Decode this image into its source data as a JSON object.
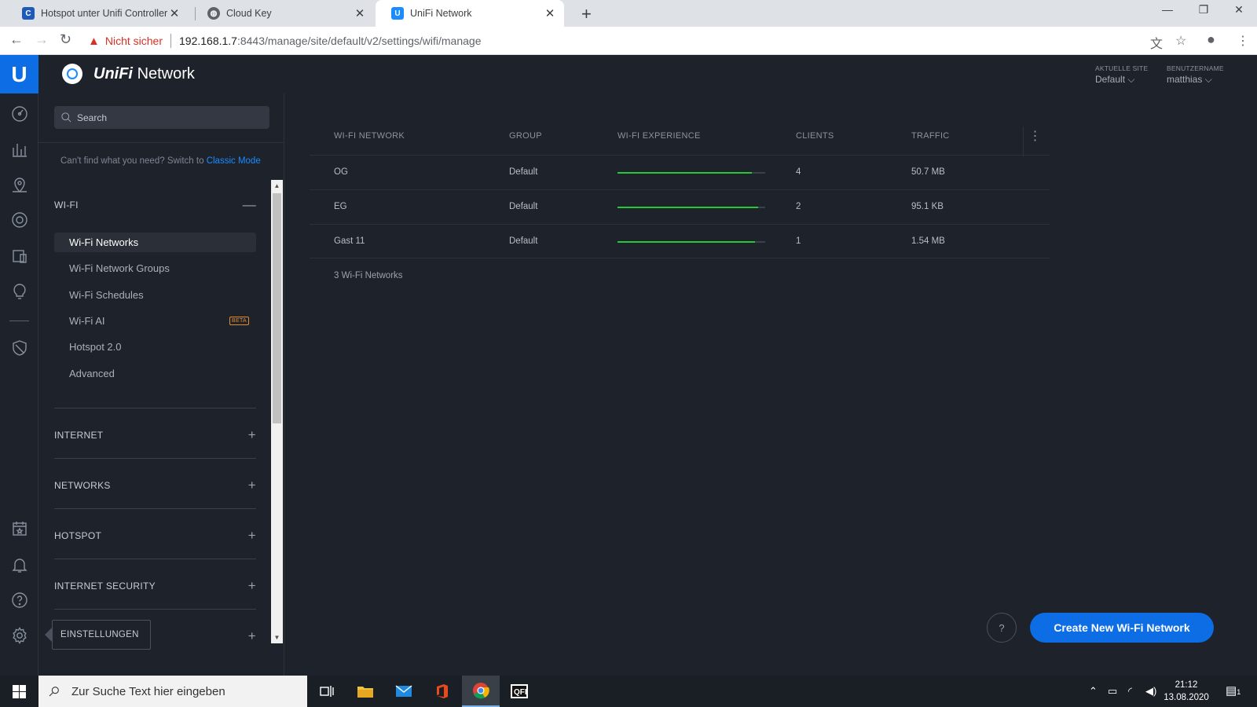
{
  "browser": {
    "tabs": [
      {
        "title": "Hotspot unter Unifi Controller | C",
        "favicon": "cb"
      },
      {
        "title": "Cloud Key",
        "favicon": "globe"
      },
      {
        "title": "UniFi Network",
        "favicon": "unifi"
      }
    ],
    "security_label": "Nicht sicher",
    "url_host": "192.168.1.7",
    "url_rest": ":8443/manage/site/default/v2/settings/wifi/manage"
  },
  "header": {
    "brand_unifi": "UniFi",
    "brand_network": "Network",
    "site_caption": "AKTUELLE SITE",
    "site_value": "Default",
    "user_caption": "BENUTZERNAME",
    "user_value": "matthias"
  },
  "sidebar": {
    "search_placeholder": "Search",
    "classic_text": "Can't find what you need? Switch to",
    "classic_link": "Classic Mode",
    "wifi_title": "WI-FI",
    "items": [
      {
        "label": "Wi-Fi Networks"
      },
      {
        "label": "Wi-Fi Network Groups"
      },
      {
        "label": "Wi-Fi Schedules"
      },
      {
        "label": "Wi-Fi AI",
        "badge": "BETA"
      },
      {
        "label": "Hotspot 2.0"
      },
      {
        "label": "Advanced"
      }
    ],
    "sections": [
      "INTERNET",
      "NETWORKS",
      "HOTSPOT",
      "INTERNET SECURITY"
    ],
    "tooltip": "EINSTELLUNGEN"
  },
  "table": {
    "columns": [
      "WI-FI NETWORK",
      "GROUP",
      "WI-FI EXPERIENCE",
      "CLIENTS",
      "TRAFFIC"
    ],
    "rows": [
      {
        "name": "OG",
        "group": "Default",
        "experience": 0.91,
        "clients": "4",
        "traffic": "50.7 MB"
      },
      {
        "name": "EG",
        "group": "Default",
        "experience": 0.95,
        "clients": "2",
        "traffic": "95.1 KB"
      },
      {
        "name": "Gast 11",
        "group": "Default",
        "experience": 0.93,
        "clients": "1",
        "traffic": "1.54 MB"
      }
    ],
    "footer": "3 Wi-Fi Networks"
  },
  "actions": {
    "help_label": "?",
    "create_label": "Create New Wi-Fi Network"
  },
  "taskbar": {
    "search_placeholder": "Zur Suche Text hier eingeben",
    "time": "21:12",
    "date": "13.08.2020",
    "notification_count": "1"
  },
  "colors": {
    "accent": "#0d6de5",
    "experience_good": "#26c83a",
    "beta": "#e38c2e",
    "warning": "#d93025"
  }
}
